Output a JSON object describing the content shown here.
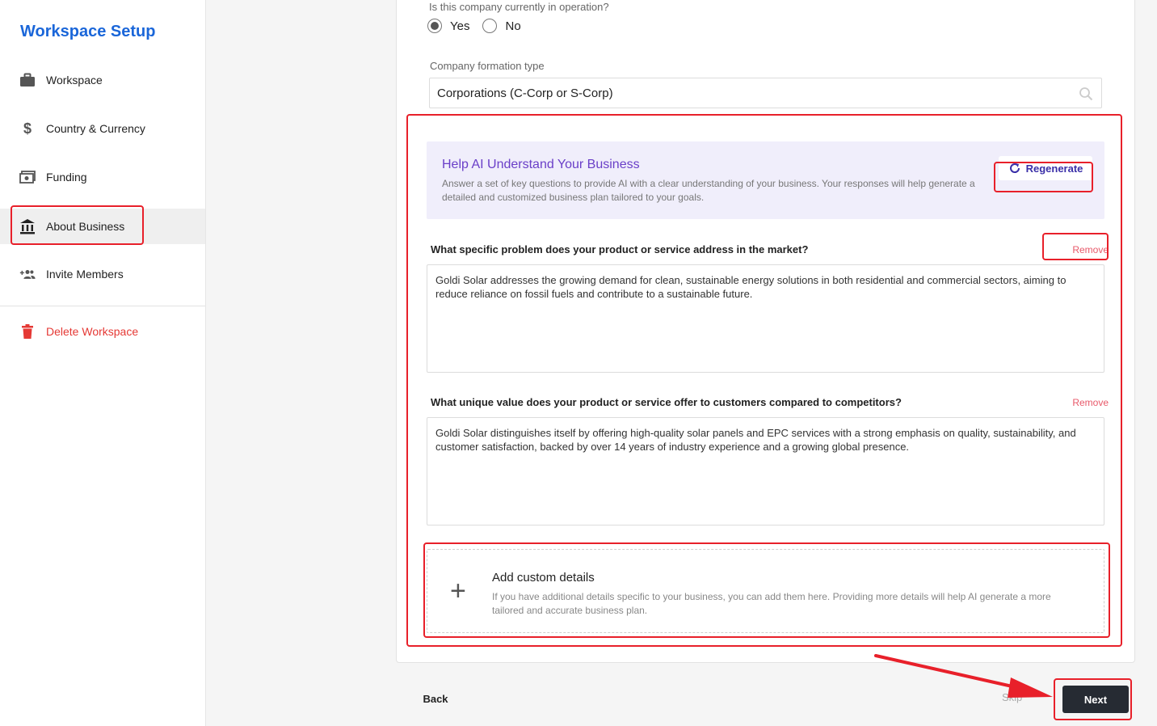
{
  "sidebar": {
    "title": "Workspace Setup",
    "items": [
      {
        "label": "Workspace",
        "icon": "briefcase-icon"
      },
      {
        "label": "Country & Currency",
        "icon": "dollar-icon"
      },
      {
        "label": "Funding",
        "icon": "money-icon"
      },
      {
        "label": "About Business",
        "icon": "bank-icon",
        "active": true
      },
      {
        "label": "Invite Members",
        "icon": "add-people-icon"
      }
    ],
    "delete_label": "Delete Workspace"
  },
  "form": {
    "operation_question": "Is this company currently in operation?",
    "options": {
      "yes": "Yes",
      "no": "No"
    },
    "selected": "Yes",
    "formation_label": "Company formation type",
    "formation_value": "Corporations (C-Corp or S-Corp)"
  },
  "ai_panel": {
    "title": "Help AI Understand Your Business",
    "description": "Answer a set of key questions to provide AI with a clear understanding of your business. Your responses will help generate a detailed and customized business plan tailored to your goals.",
    "regenerate_label": "Regenerate"
  },
  "questions": [
    {
      "question": "What specific problem does your product or service address in the market?",
      "remove_label": "Remove",
      "answer": "Goldi Solar addresses the growing demand for clean, sustainable energy solutions in both residential and commercial sectors, aiming to reduce reliance on fossil fuels and contribute to a sustainable future."
    },
    {
      "question": "What unique value does your product or service offer to customers compared to competitors?",
      "remove_label": "Remove",
      "answer": "Goldi Solar distinguishes itself by offering high-quality solar panels and EPC services with a strong emphasis on quality, sustainability, and customer satisfaction, backed by over 14 years of industry experience and a growing global presence."
    }
  ],
  "custom_details": {
    "title": "Add custom details",
    "description": "If you have additional details specific to your business, you can add them here. Providing more details will help AI generate a more tailored and accurate business plan."
  },
  "footer": {
    "back_label": "Back",
    "skip_label": "Skip",
    "next_label": "Next"
  },
  "colors": {
    "brand": "#1a66d9",
    "ai_accent": "#6a3fc8",
    "highlight": "#e8202a",
    "danger": "#e53935",
    "next_bg": "#262b33"
  }
}
